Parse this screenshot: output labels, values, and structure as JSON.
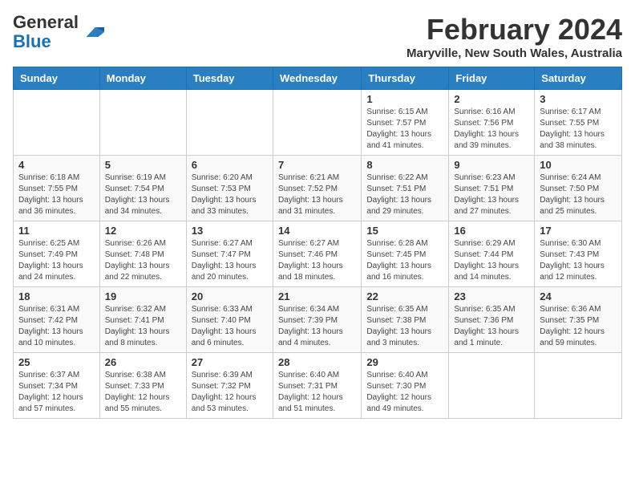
{
  "header": {
    "logo_general": "General",
    "logo_blue": "Blue",
    "month_title": "February 2024",
    "location": "Maryville, New South Wales, Australia"
  },
  "weekdays": [
    "Sunday",
    "Monday",
    "Tuesday",
    "Wednesday",
    "Thursday",
    "Friday",
    "Saturday"
  ],
  "weeks": [
    [
      {
        "day": "",
        "info": ""
      },
      {
        "day": "",
        "info": ""
      },
      {
        "day": "",
        "info": ""
      },
      {
        "day": "",
        "info": ""
      },
      {
        "day": "1",
        "info": "Sunrise: 6:15 AM\nSunset: 7:57 PM\nDaylight: 13 hours and 41 minutes."
      },
      {
        "day": "2",
        "info": "Sunrise: 6:16 AM\nSunset: 7:56 PM\nDaylight: 13 hours and 39 minutes."
      },
      {
        "day": "3",
        "info": "Sunrise: 6:17 AM\nSunset: 7:55 PM\nDaylight: 13 hours and 38 minutes."
      }
    ],
    [
      {
        "day": "4",
        "info": "Sunrise: 6:18 AM\nSunset: 7:55 PM\nDaylight: 13 hours and 36 minutes."
      },
      {
        "day": "5",
        "info": "Sunrise: 6:19 AM\nSunset: 7:54 PM\nDaylight: 13 hours and 34 minutes."
      },
      {
        "day": "6",
        "info": "Sunrise: 6:20 AM\nSunset: 7:53 PM\nDaylight: 13 hours and 33 minutes."
      },
      {
        "day": "7",
        "info": "Sunrise: 6:21 AM\nSunset: 7:52 PM\nDaylight: 13 hours and 31 minutes."
      },
      {
        "day": "8",
        "info": "Sunrise: 6:22 AM\nSunset: 7:51 PM\nDaylight: 13 hours and 29 minutes."
      },
      {
        "day": "9",
        "info": "Sunrise: 6:23 AM\nSunset: 7:51 PM\nDaylight: 13 hours and 27 minutes."
      },
      {
        "day": "10",
        "info": "Sunrise: 6:24 AM\nSunset: 7:50 PM\nDaylight: 13 hours and 25 minutes."
      }
    ],
    [
      {
        "day": "11",
        "info": "Sunrise: 6:25 AM\nSunset: 7:49 PM\nDaylight: 13 hours and 24 minutes."
      },
      {
        "day": "12",
        "info": "Sunrise: 6:26 AM\nSunset: 7:48 PM\nDaylight: 13 hours and 22 minutes."
      },
      {
        "day": "13",
        "info": "Sunrise: 6:27 AM\nSunset: 7:47 PM\nDaylight: 13 hours and 20 minutes."
      },
      {
        "day": "14",
        "info": "Sunrise: 6:27 AM\nSunset: 7:46 PM\nDaylight: 13 hours and 18 minutes."
      },
      {
        "day": "15",
        "info": "Sunrise: 6:28 AM\nSunset: 7:45 PM\nDaylight: 13 hours and 16 minutes."
      },
      {
        "day": "16",
        "info": "Sunrise: 6:29 AM\nSunset: 7:44 PM\nDaylight: 13 hours and 14 minutes."
      },
      {
        "day": "17",
        "info": "Sunrise: 6:30 AM\nSunset: 7:43 PM\nDaylight: 13 hours and 12 minutes."
      }
    ],
    [
      {
        "day": "18",
        "info": "Sunrise: 6:31 AM\nSunset: 7:42 PM\nDaylight: 13 hours and 10 minutes."
      },
      {
        "day": "19",
        "info": "Sunrise: 6:32 AM\nSunset: 7:41 PM\nDaylight: 13 hours and 8 minutes."
      },
      {
        "day": "20",
        "info": "Sunrise: 6:33 AM\nSunset: 7:40 PM\nDaylight: 13 hours and 6 minutes."
      },
      {
        "day": "21",
        "info": "Sunrise: 6:34 AM\nSunset: 7:39 PM\nDaylight: 13 hours and 4 minutes."
      },
      {
        "day": "22",
        "info": "Sunrise: 6:35 AM\nSunset: 7:38 PM\nDaylight: 13 hours and 3 minutes."
      },
      {
        "day": "23",
        "info": "Sunrise: 6:35 AM\nSunset: 7:36 PM\nDaylight: 13 hours and 1 minute."
      },
      {
        "day": "24",
        "info": "Sunrise: 6:36 AM\nSunset: 7:35 PM\nDaylight: 12 hours and 59 minutes."
      }
    ],
    [
      {
        "day": "25",
        "info": "Sunrise: 6:37 AM\nSunset: 7:34 PM\nDaylight: 12 hours and 57 minutes."
      },
      {
        "day": "26",
        "info": "Sunrise: 6:38 AM\nSunset: 7:33 PM\nDaylight: 12 hours and 55 minutes."
      },
      {
        "day": "27",
        "info": "Sunrise: 6:39 AM\nSunset: 7:32 PM\nDaylight: 12 hours and 53 minutes."
      },
      {
        "day": "28",
        "info": "Sunrise: 6:40 AM\nSunset: 7:31 PM\nDaylight: 12 hours and 51 minutes."
      },
      {
        "day": "29",
        "info": "Sunrise: 6:40 AM\nSunset: 7:30 PM\nDaylight: 12 hours and 49 minutes."
      },
      {
        "day": "",
        "info": ""
      },
      {
        "day": "",
        "info": ""
      }
    ]
  ]
}
